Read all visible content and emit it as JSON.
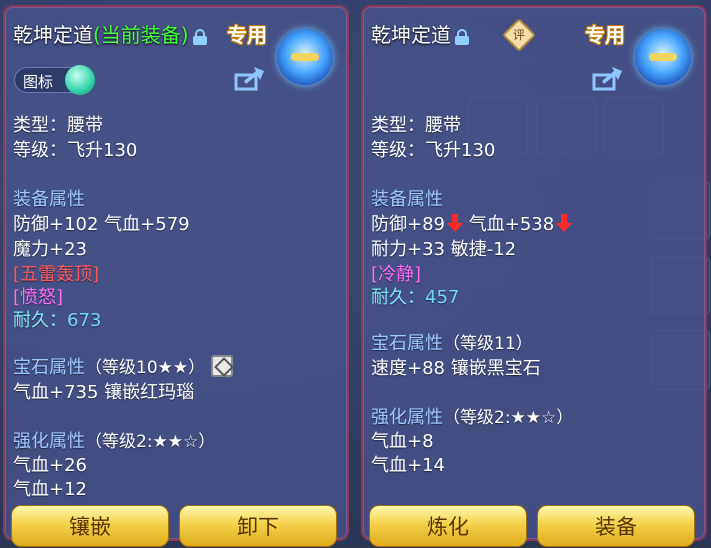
{
  "left": {
    "title": "乾坤定道",
    "title_current": "(当前装备)",
    "exclusive": "专用",
    "icon_toggle_label": "图标",
    "type_line": "类型：腰带",
    "level_line": "等级：飞升130",
    "attr_header": "装备属性",
    "attr1": "防御+102 气血+579",
    "attr2": "魔力+23",
    "special1": "[五雷轰顶]",
    "special2": "[愤怒]",
    "durability_label": "耐久：",
    "durability_value": "673",
    "gem_header": "宝石属性",
    "gem_level": "（等级10★★）",
    "gem_line": "气血+735 镶嵌红玛瑙",
    "enh_header": "强化属性",
    "enh_level": "（等级2:★★☆）",
    "enh1": "气血+26",
    "enh2": "气血+12",
    "btn1": "镶嵌",
    "btn2": "卸下"
  },
  "right": {
    "title": "乾坤定道",
    "rate_badge": "评",
    "exclusive": "专用",
    "type_line": "类型：腰带",
    "level_line": "等级：飞升130",
    "attr_header": "装备属性",
    "attr1a": "防御+89",
    "attr1b": "气血+538",
    "attr2": "耐力+33 敏捷-12",
    "special1": "[冷静]",
    "durability_label": "耐久：",
    "durability_value": "457",
    "gem_header": "宝石属性",
    "gem_level": "（等级11）",
    "gem_line": "速度+88 镶嵌黑宝石",
    "enh_header": "强化属性",
    "enh_level": "（等级2:★★☆）",
    "enh1": "气血+8",
    "enh2": "气血+14",
    "btn1": "炼化",
    "btn2": "装备"
  },
  "icons": {
    "lock": "lock-icon",
    "share": "share-icon",
    "emblem": "equipment-emblem-icon",
    "down": "arrow-down-icon",
    "gem": "gem-icon"
  },
  "colors": {
    "current_equipped": "#41ff3a",
    "header": "#9ec9ff",
    "special_red": "#ff5a5a",
    "special_pink": "#ff6cff",
    "durability": "#6fd8ff",
    "button": "#f4d24a"
  }
}
